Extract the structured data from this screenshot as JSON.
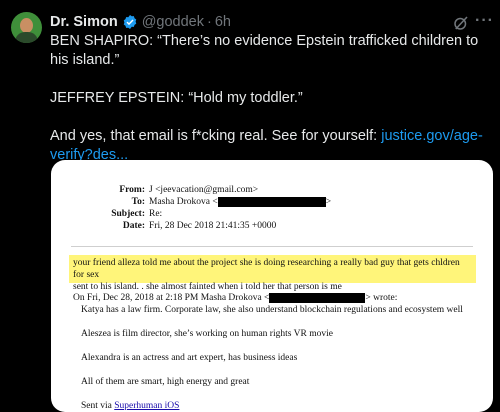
{
  "tweet": {
    "display_name": "Dr. Simon",
    "handle": "@goddek",
    "separator": "·",
    "time": "6h",
    "more": "···",
    "paragraphs": {
      "p1": "BEN SHAPIRO: “There’s no evidence Epstein trafficked children to his island.”",
      "p2": "JEFFREY EPSTEIN: “Hold my toddler.”",
      "p3_text": "And yes, that email is f*cking real. See for yourself: ",
      "p3_link": "justice.gov/age-verify?des..."
    }
  },
  "email": {
    "from_label": "From:",
    "from_value": "J <jeevacation@gmail.com>",
    "to_label": "To:",
    "to_value": "Masha Drokova <",
    "to_end": ">",
    "subject_label": "Subject:",
    "subject_value": "Re:",
    "date_label": "Date:",
    "date_value": "Fri, 28 Dec 2018 21:41:35 +0000",
    "highlighted_line1": "your friend alleza  told me about the project she is doing  researching a really bad guy that gets chldren for sex",
    "highlighted_line2": "sent to his island.    .   she almost fainted when i told her that person is me",
    "on_fri_pre": "On Fri, Dec 28, 2018 at 2:18 PM Masha Drokova <",
    "on_fri_post": "> wrote:",
    "quoted": {
      "q1": "Katya has a law firm. Corporate law, she also understand blockchain regulations and ecosystem well",
      "q2": "Aleszea is film director, she’s working on human rights VR movie",
      "q3": "Alexandra is an actress and art expert, has business ideas",
      "q4": "All of them are smart, high energy and great",
      "q5_pre": "Sent via ",
      "q5_link": "Superhuman iOS"
    }
  },
  "colors": {
    "background": "#000000",
    "link": "#1d9bf0",
    "verified": "#1d9bf0",
    "highlight": "#fff57a",
    "muted": "#71767b"
  },
  "icons": [
    "avatar",
    "verified-badge-icon",
    "grok-icon",
    "more-options-icon"
  ]
}
